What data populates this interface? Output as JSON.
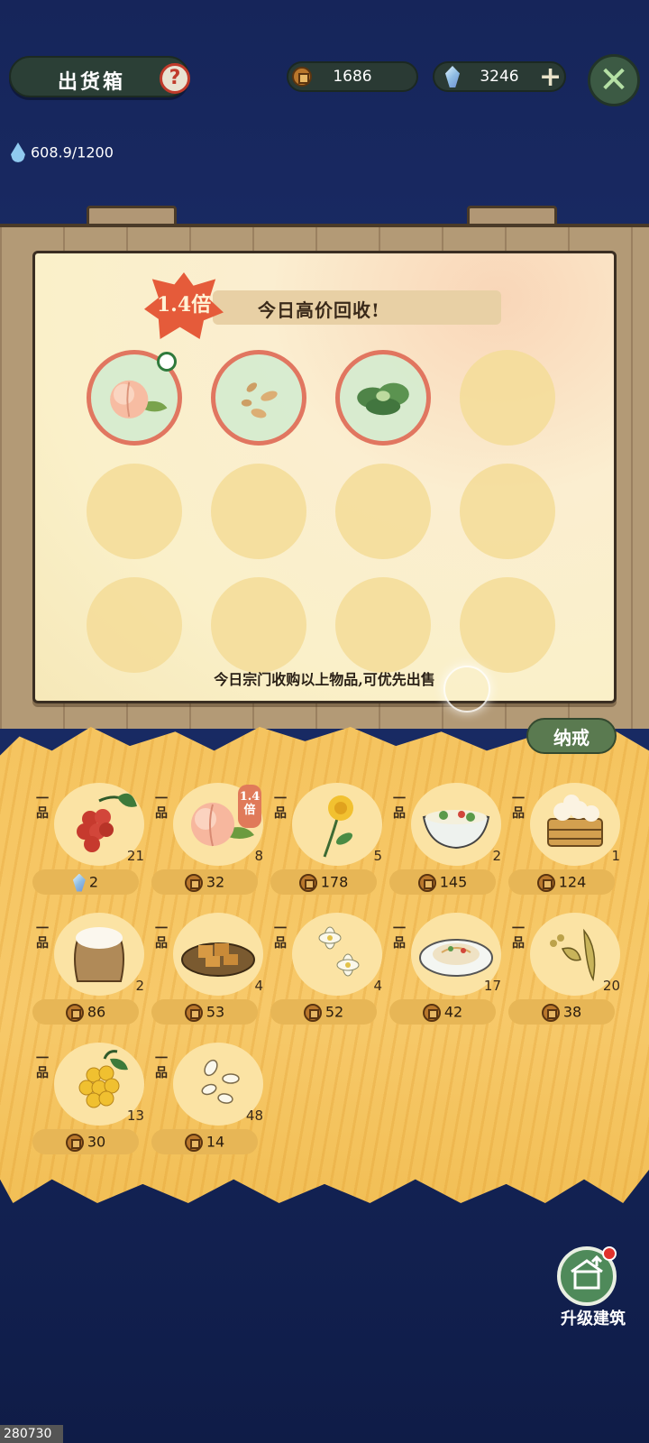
{
  "header": {
    "title": "出货箱",
    "help_icon": "question-icon",
    "coins": "1686",
    "gems": "3246",
    "add_label": "+",
    "close_icon": "close-x-icon"
  },
  "water": {
    "value": "608.9/1200",
    "icon": "water-drop-icon"
  },
  "notice": {
    "multiplier": "1.4倍",
    "banner": "今日高价回收!",
    "wanted_items": [
      {
        "name": "peach",
        "icon": "peach-icon"
      },
      {
        "name": "seeds",
        "icon": "seeds-icon"
      },
      {
        "name": "bok-choy",
        "icon": "bok-choy-icon"
      }
    ],
    "footer": "今日宗门收购以上物品,可优先出售"
  },
  "inventory_tab": "纳戒",
  "grade_label": "一品",
  "inventory": [
    {
      "icon": "red-berries-icon",
      "count": "21",
      "price": "2",
      "currency": "gem"
    },
    {
      "icon": "peach-icon",
      "count": "8",
      "price": "32",
      "currency": "coin",
      "boost": "1.4倍"
    },
    {
      "icon": "chrysanthemum-icon",
      "count": "5",
      "price": "178",
      "currency": "coin"
    },
    {
      "icon": "noodle-bowl-icon",
      "count": "2",
      "price": "145",
      "currency": "coin"
    },
    {
      "icon": "steamed-buns-icon",
      "count": "1",
      "price": "124",
      "currency": "coin"
    },
    {
      "icon": "flour-sack-icon",
      "count": "2",
      "price": "86",
      "currency": "coin"
    },
    {
      "icon": "tofu-plate-icon",
      "count": "4",
      "price": "53",
      "currency": "coin"
    },
    {
      "icon": "jasmine-flower-icon",
      "count": "4",
      "price": "52",
      "currency": "coin"
    },
    {
      "icon": "noodle-plate-icon",
      "count": "17",
      "price": "42",
      "currency": "coin"
    },
    {
      "icon": "soybean-icon",
      "count": "20",
      "price": "38",
      "currency": "coin"
    },
    {
      "icon": "golden-berries-icon",
      "count": "13",
      "price": "30",
      "currency": "coin"
    },
    {
      "icon": "seeds-icon",
      "count": "48",
      "price": "14",
      "currency": "coin"
    }
  ],
  "upgrade": {
    "label": "升级建筑",
    "icon": "building-upgrade-icon"
  },
  "build_id": "280730",
  "colors": {
    "background": "#1b2e6b",
    "paper": "#faf0c9",
    "hay": "#f5c45f",
    "accent_red": "#e55b3a",
    "jade_green": "#4f8a5a"
  }
}
